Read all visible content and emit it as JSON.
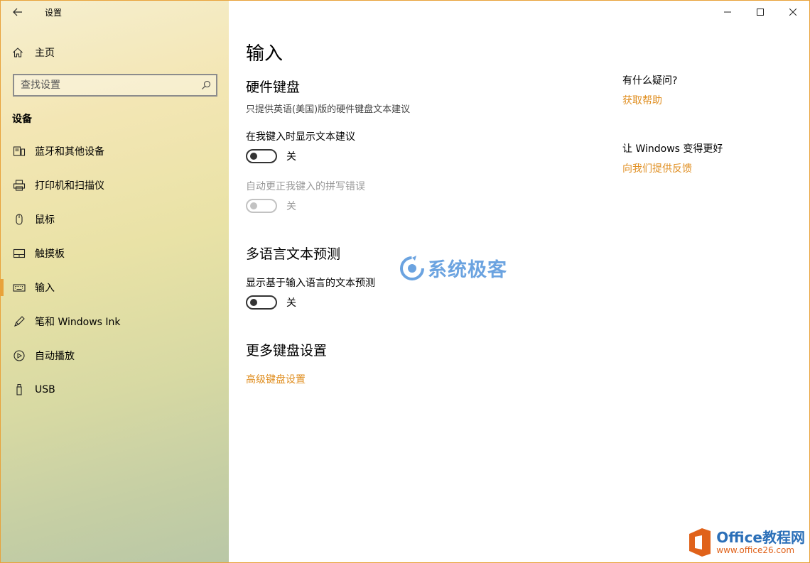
{
  "colors": {
    "accent": "#e08f22",
    "border": "#e8a23a"
  },
  "window": {
    "title": "设置"
  },
  "sidebar": {
    "home_label": "主页",
    "search_placeholder": "查找设置",
    "section_title": "设备",
    "items": [
      {
        "label": "蓝牙和其他设备",
        "icon": "bluetooth-devices-icon"
      },
      {
        "label": "打印机和扫描仪",
        "icon": "printer-icon"
      },
      {
        "label": "鼠标",
        "icon": "mouse-icon"
      },
      {
        "label": "触摸板",
        "icon": "touchpad-icon"
      },
      {
        "label": "输入",
        "icon": "keyboard-icon",
        "selected": true
      },
      {
        "label": "笔和 Windows Ink",
        "icon": "pen-icon"
      },
      {
        "label": "自动播放",
        "icon": "autoplay-icon"
      },
      {
        "label": "USB",
        "icon": "usb-icon"
      }
    ]
  },
  "main": {
    "title": "输入",
    "hardware": {
      "heading": "硬件键盘",
      "description": "只提供英语(美国)版的硬件键盘文本建议",
      "suggest_label": "在我键入时显示文本建议",
      "suggest_state": "关",
      "autocorrect_label": "自动更正我键入的拼写错误",
      "autocorrect_state": "关"
    },
    "multilingual": {
      "heading": "多语言文本预测",
      "predict_label": "显示基于输入语言的文本预测",
      "predict_state": "关"
    },
    "more": {
      "heading": "更多键盘设置",
      "advanced_link": "高级键盘设置"
    }
  },
  "side_panel": {
    "question": "有什么疑问?",
    "help_link": "获取帮助",
    "improve": "让 Windows 变得更好",
    "feedback_link": "向我们提供反馈"
  },
  "watermarks": {
    "center": "系统极客",
    "corner_brand": "Office教程网",
    "corner_url": "www.office26.com"
  }
}
